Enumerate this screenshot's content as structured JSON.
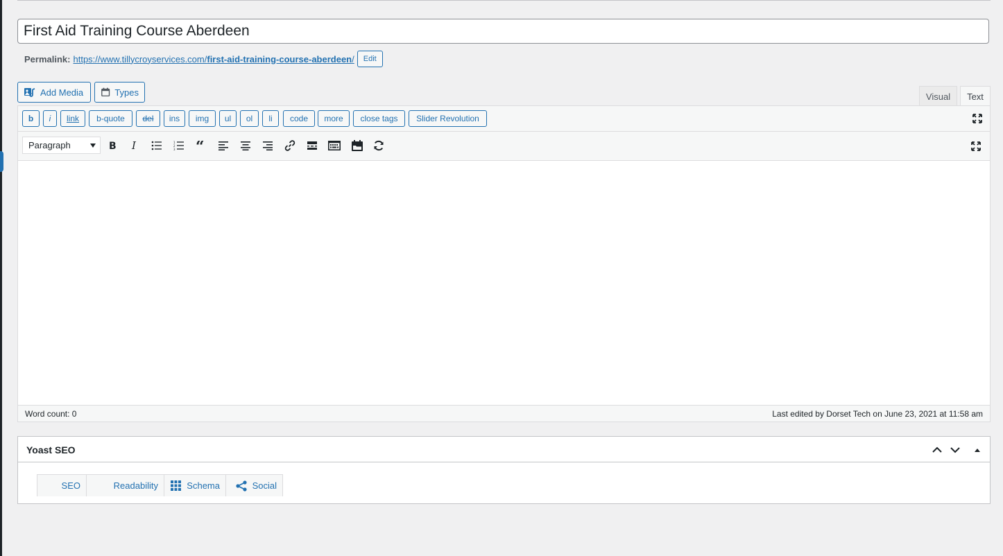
{
  "post": {
    "title": "First Aid Training Course Aberdeen",
    "permalink_label": "Permalink:",
    "permalink_base": "https://www.tillycroyservices.com/",
    "permalink_slug": "first-aid-training-course-aberdeen",
    "permalink_trail": "/",
    "edit_label": "Edit"
  },
  "media_buttons": {
    "add_media": "Add Media",
    "types": "Types"
  },
  "editor_tabs": {
    "visual": "Visual",
    "text": "Text",
    "active": "text"
  },
  "quicktags": [
    "b",
    "i",
    "link",
    "b-quote",
    "del",
    "ins",
    "img",
    "ul",
    "ol",
    "li",
    "code",
    "more",
    "close tags",
    "Slider Revolution"
  ],
  "toolbar": {
    "format_value": "Paragraph",
    "icons": [
      "bold-icon",
      "italic-icon",
      "bullet-list-icon",
      "numbered-list-icon",
      "blockquote-icon",
      "align-left-icon",
      "align-center-icon",
      "align-right-icon",
      "link-icon",
      "read-more-icon",
      "toolbar-toggle-icon",
      "types-field-icon",
      "slider-revolution-icon"
    ]
  },
  "status": {
    "word_count": "Word count: 0",
    "last_edited": "Last edited by Dorset Tech on June 23, 2021 at 11:58 am"
  },
  "yoast": {
    "title": "Yoast SEO",
    "tabs": [
      "SEO",
      "Readability",
      "Schema",
      "Social"
    ]
  },
  "colors": {
    "accent": "#2271b1",
    "background": "#f0f0f1",
    "border": "#dcdcde"
  }
}
